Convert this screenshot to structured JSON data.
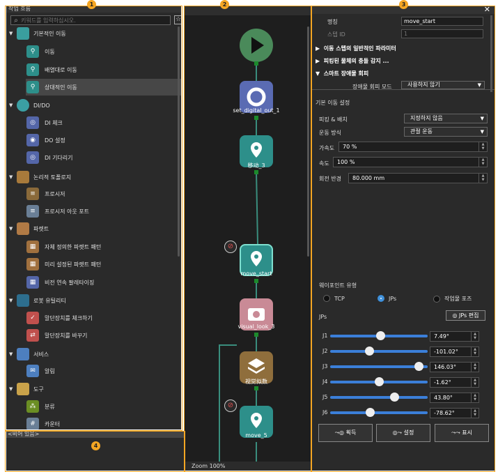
{
  "badges": [
    "1",
    "2",
    "3",
    "4"
  ],
  "left": {
    "title": "작업 흐름",
    "search_placeholder": "키워드를 입력하십시오.",
    "fav_icon": "☆",
    "categories": [
      {
        "label": "기본적인 이동",
        "color": "#3a9e9e"
      },
      {
        "label": "DI/DO",
        "color": "#3b9fa3"
      },
      {
        "label": "논리적 토폴로지",
        "color": "#a87a3b"
      },
      {
        "label": "파렛트",
        "color": "#b07a45"
      },
      {
        "label": "로봇 유틸리티",
        "color": "#2d6e8e"
      },
      {
        "label": "서비스",
        "color": "#4d7fbf"
      },
      {
        "label": "도구",
        "color": "#c9a24a"
      }
    ],
    "items": [
      {
        "label": "이동",
        "color": "#2d8f8a"
      },
      {
        "label": "배열대로 이동",
        "color": "#2d8f8a"
      },
      {
        "label": "상대적인 이동",
        "color": "#2d8f8a"
      },
      {
        "label": "DI 체크",
        "color": "#5466a8"
      },
      {
        "label": "DO 설정",
        "color": "#5466a8"
      },
      {
        "label": "DI 기다리기",
        "color": "#5466a8"
      },
      {
        "label": "프로시저",
        "color": "#8a6a3a"
      },
      {
        "label": "프로시저 아웃 포트",
        "color": "#6a7f96"
      },
      {
        "label": "자체 정의한 파렛트 패턴",
        "color": "#a0703e"
      },
      {
        "label": "미리 설정된 파렛트 패턴",
        "color": "#a0703e"
      },
      {
        "label": "비전 연속 팔레타이징",
        "color": "#5466a8"
      },
      {
        "label": "말단장치를 체크하기",
        "color": "#c0504d"
      },
      {
        "label": "말단장치를 바꾸기",
        "color": "#c0504d"
      },
      {
        "label": "알림",
        "color": "#4d7fbf"
      },
      {
        "label": "분류",
        "color": "#6b8e23"
      },
      {
        "label": "카운터",
        "color": "#6a7f96"
      }
    ]
  },
  "bottom": {
    "empty_label": "<비어 있음>"
  },
  "canvas": {
    "zoom": "Zoom 100%",
    "nodes": [
      {
        "label": "set_digital_out_1"
      },
      {
        "label": "移动_3"
      },
      {
        "label": "move_start"
      },
      {
        "label": "visual_look_3"
      },
      {
        "label": "视觉拟数"
      },
      {
        "label": "move_5"
      }
    ]
  },
  "props": {
    "close": "✕",
    "name_label": "명칭",
    "name_value": "move_start",
    "step_label": "스텝 ID",
    "step_value": "1",
    "sections": [
      "이동 스텝의 일반적인 파라미터",
      "피킹된 물체의 충돌 감지 ...",
      "스마트 장애물 회피"
    ],
    "avoid_label": "장애물 회피 모드",
    "avoid_value": "사용하지 않기",
    "basic_title": "기본 이동 설정",
    "picking_label": "피킹 & 배치",
    "picking_value": "지정하지 않음",
    "motion_label": "운동 방식",
    "motion_value": "관절 운동",
    "acc_label": "가속도",
    "acc_value": "70 %",
    "speed_label": "속도",
    "speed_value": "100 %",
    "radius_label": "회전 반경",
    "radius_value": "80.000 mm",
    "wp_title": "웨이포인트 유형",
    "radios": [
      "TCP",
      "JPs",
      "작업물 포즈"
    ],
    "radio_selected": 1,
    "jps_label": "JPs",
    "jps_edit": "JPs 편집",
    "joints": [
      {
        "name": "J1",
        "value": "7.49°",
        "frac": 0.52
      },
      {
        "name": "J2",
        "value": "-101.02°",
        "frac": 0.39
      },
      {
        "name": "J3",
        "value": "146.03°",
        "frac": 0.95
      },
      {
        "name": "J4",
        "value": "-1.62°",
        "frac": 0.5
      },
      {
        "name": "J5",
        "value": "43.80°",
        "frac": 0.68
      },
      {
        "name": "J6",
        "value": "-78.62°",
        "frac": 0.4
      }
    ],
    "buttons": [
      "획득",
      "설정",
      "표시"
    ]
  }
}
